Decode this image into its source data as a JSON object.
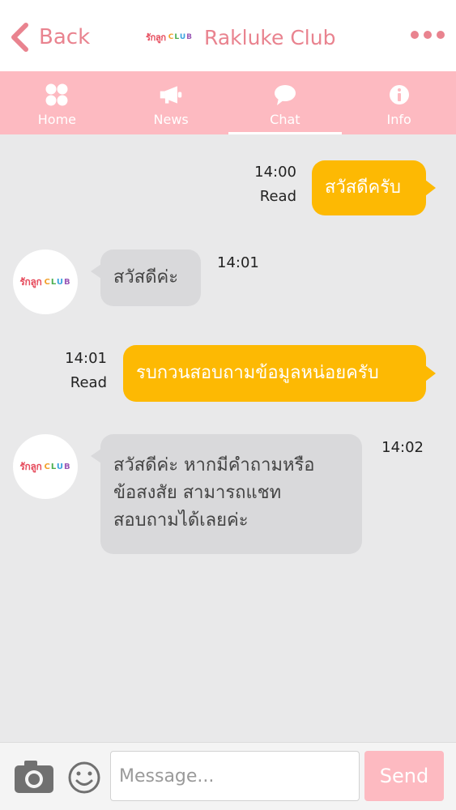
{
  "header": {
    "back_label": "Back",
    "title": "Rakluke Club",
    "logo_main": "รักลูก",
    "logo_club": [
      "C",
      "L",
      "U",
      "B"
    ]
  },
  "colors": {
    "accent": "#e9838f",
    "tabbar": "#fdbac1",
    "outgoing_bubble": "#fdb903",
    "incoming_bubble": "#d9d9db",
    "club_letters": [
      "#f2a12c",
      "#4caf50",
      "#3ba3e0",
      "#9b59b6"
    ]
  },
  "tabs": [
    {
      "label": "Home",
      "icon": "home-grid-icon"
    },
    {
      "label": "News",
      "icon": "megaphone-icon"
    },
    {
      "label": "Chat",
      "icon": "chat-bubble-icon",
      "active": true
    },
    {
      "label": "Info",
      "icon": "info-icon"
    }
  ],
  "messages": [
    {
      "direction": "out",
      "text": "สวัสดีครับ",
      "time": "14:00",
      "status": "Read"
    },
    {
      "direction": "in",
      "text": "สวัสดีค่ะ",
      "time": "14:01"
    },
    {
      "direction": "out",
      "text": "รบกวนสอบถามข้อมูลหน่อยครับ",
      "time": "14:01",
      "status": "Read"
    },
    {
      "direction": "in",
      "lines": [
        "สวัสดีค่ะ หากมีคำถามหรือ",
        "ข้อสงสัย สามารถแชท",
        "สอบถามได้เลยค่ะ"
      ],
      "time": "14:02"
    }
  ],
  "input": {
    "placeholder": "Message...",
    "value": "",
    "send_label": "Send"
  }
}
